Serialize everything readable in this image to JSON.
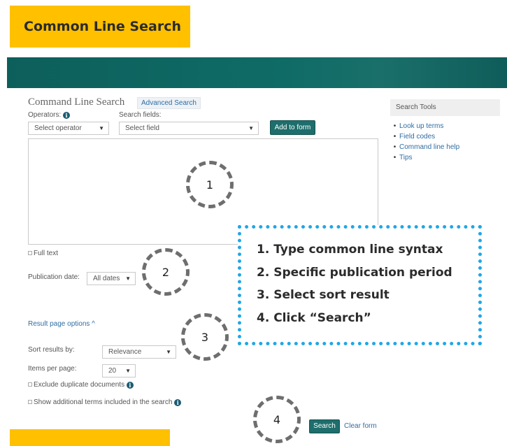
{
  "slide": {
    "title": "Common Line Search"
  },
  "page": {
    "title": "Command Line Search",
    "advanced_link": "Advanced Search"
  },
  "form": {
    "operators_label": "Operators:",
    "operators_info": "i",
    "operators_value": "Select operator",
    "fields_label": "Search fields:",
    "fields_value": "Select field",
    "add_button": "Add to form",
    "query_value": "",
    "full_text": "Full text",
    "pub_date_label": "Publication date:",
    "pub_date_value": "All dates",
    "result_options": "Result page options ^",
    "sort_label": "Sort results by:",
    "sort_value": "Relevance",
    "items_label": "Items per page:",
    "items_value": "20",
    "exclude_dup": "Exclude duplicate documents",
    "show_terms": "Show additional terms included in the search",
    "search_button": "Search",
    "clear_link": "Clear form"
  },
  "search_tools": {
    "title": "Search Tools",
    "items": [
      "Look up terms",
      "Field codes",
      "Command line help",
      "Tips"
    ]
  },
  "callouts": [
    "1",
    "2",
    "3",
    "4"
  ],
  "steps": [
    "1. Type common line syntax",
    "2. Specific publication period",
    "3. Select sort result",
    "4. Click “Search”"
  ],
  "colors": {
    "accent": "#ffc000",
    "banner": "#0f6b66",
    "steps_border": "#20a7e6",
    "button": "#1d6e6c"
  }
}
